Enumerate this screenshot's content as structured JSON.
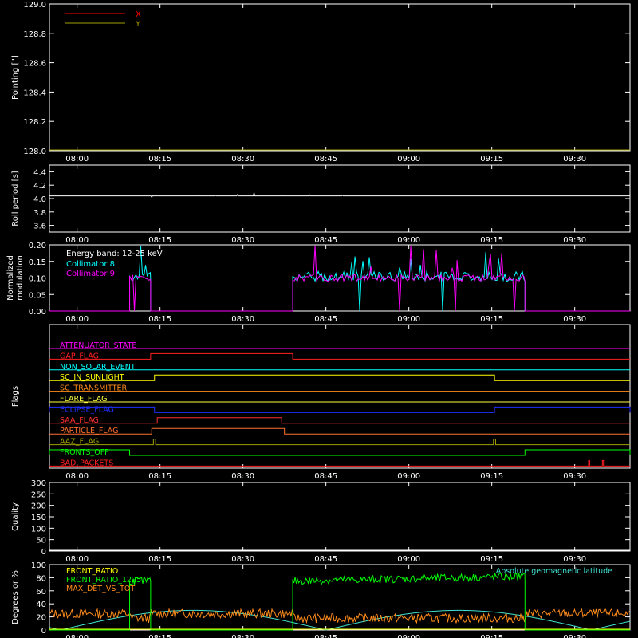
{
  "colors": {
    "background": "#000000",
    "axes": "#ffffff",
    "x_series": "#ff0000",
    "y_series": "#a0a000",
    "collimator8": "#00ffff",
    "collimator9": "#ff00ff",
    "front_ratio": "#00ff00",
    "max_det": "#ff8c1a",
    "geomag": "#40e0d0"
  },
  "chart_data": [
    {
      "id": "pointing",
      "type": "line",
      "ylabel": "Pointing [\"]",
      "ylim": [
        128.0,
        129.0
      ],
      "yticks": [
        "128.0",
        "128.2",
        "128.4",
        "128.6",
        "128.8",
        "129.0"
      ],
      "xlim_minutes": [
        -5,
        100
      ],
      "xticks": [
        "08:00",
        "08:15",
        "08:30",
        "08:45",
        "09:00",
        "09:15",
        "09:30"
      ],
      "legend": [
        {
          "name": "X",
          "color": "#ff0000"
        },
        {
          "name": "Y",
          "color": "#a0a000"
        }
      ],
      "series": [
        {
          "name": "X",
          "values": [
            128.0,
            128.0
          ]
        },
        {
          "name": "Y",
          "values": [
            128.0,
            128.0
          ]
        }
      ]
    },
    {
      "id": "roll",
      "type": "line",
      "ylabel": "Roll period [s]",
      "ylim": [
        3.5,
        4.5
      ],
      "yticks": [
        "3.6",
        "3.8",
        "4.0",
        "4.2",
        "4.4"
      ],
      "xticks": [
        "08:00",
        "08:15",
        "08:30",
        "08:45",
        "09:00",
        "09:15",
        "09:30"
      ],
      "series": [
        {
          "name": "Roll period",
          "x": [
            -5,
            100
          ],
          "values": [
            4.04,
            4.04
          ]
        }
      ],
      "bumps": [
        {
          "x": 13.5,
          "y": 4.02
        },
        {
          "x": 22,
          "y": 4.05
        },
        {
          "x": 25,
          "y": 4.05
        },
        {
          "x": 29,
          "y": 4.06
        },
        {
          "x": 32,
          "y": 4.09
        },
        {
          "x": 37,
          "y": 4.05
        },
        {
          "x": 42,
          "y": 4.06
        },
        {
          "x": 48,
          "y": 4.05
        }
      ]
    },
    {
      "id": "modulation",
      "type": "line",
      "ylabel": "Normalized modulation",
      "ylim": [
        0.0,
        0.2
      ],
      "yticks": [
        "0.00",
        "0.05",
        "0.10",
        "0.15",
        "0.20"
      ],
      "xticks": [
        "08:00",
        "08:15",
        "08:30",
        "08:45",
        "09:00",
        "09:15",
        "09:30"
      ],
      "annotation": "Energy band: 12-25 keV",
      "legend": [
        {
          "name": "Collimator 8",
          "color": "#00ffff"
        },
        {
          "name": "Collimator 9",
          "color": "#ff00ff"
        }
      ],
      "active_intervals": [
        [
          9.5,
          13.3
        ],
        [
          39.0,
          81.0
        ]
      ],
      "base_level": 0.09,
      "peak_level": 0.2
    },
    {
      "id": "flags",
      "type": "step",
      "ylabel": "Flags",
      "xticks": [
        "08:00",
        "08:15",
        "08:30",
        "08:45",
        "09:00",
        "09:15",
        "09:30"
      ],
      "flags": [
        {
          "name": "ATTENUATOR_STATE",
          "color": "#ff00ff",
          "steps": []
        },
        {
          "name": "GAP_FLAG",
          "color": "#ff2020",
          "steps": [
            [
              13.3,
              39.0
            ]
          ]
        },
        {
          "name": "NON_SOLAR_EVENT",
          "color": "#00ffff",
          "steps": []
        },
        {
          "name": "SC_IN_SUNLIGHT",
          "color": "#ffff00",
          "steps": [
            [
              14.0,
              75.5
            ]
          ]
        },
        {
          "name": "SC_TRANSMITTER",
          "color": "#ff8c1a",
          "steps": []
        },
        {
          "name": "FLARE_FLAG",
          "color": "#ffff40",
          "steps": []
        },
        {
          "name": "ECLIPSE_FLAG",
          "color": "#2030ff",
          "steps": [
            [
              -5,
              14.0
            ],
            [
              75.5,
              100
            ]
          ]
        },
        {
          "name": "SAA_FLAG",
          "color": "#ff3030",
          "steps": [
            [
              14.5,
              37.0
            ]
          ]
        },
        {
          "name": "PARTICLE_FLAG",
          "color": "#ff7030",
          "steps": [
            [
              13.5,
              37.5
            ]
          ]
        },
        {
          "name": "AAZ_FLAG",
          "color": "#a0a000",
          "steps": [
            [
              13.8,
              14.2
            ],
            [
              75.3,
              75.7
            ]
          ]
        },
        {
          "name": "FRONTS_OFF",
          "color": "#00ff00",
          "steps": [
            [
              -5,
              9.5
            ],
            [
              81.0,
              100
            ]
          ]
        },
        {
          "name": "BAD_PACKETS",
          "color": "#ff2020",
          "steps": [
            [
              92.5,
              92.7
            ],
            [
              95.0,
              95.2
            ]
          ]
        }
      ]
    },
    {
      "id": "quality",
      "type": "line",
      "ylabel": "Quality",
      "ylim": [
        0,
        300
      ],
      "yticks": [
        "0",
        "50",
        "100",
        "150",
        "200",
        "250",
        "300"
      ],
      "xticks": [
        "08:00",
        "08:15",
        "08:30",
        "08:45",
        "09:00",
        "09:15",
        "09:30"
      ],
      "series": [
        {
          "name": "Quality",
          "x": [
            -5,
            100
          ],
          "values": [
            0,
            0
          ]
        }
      ]
    },
    {
      "id": "ratios",
      "type": "line",
      "ylabel": "Degrees or %",
      "ylim": [
        0,
        100
      ],
      "yticks": [
        "0",
        "20",
        "40",
        "60",
        "80",
        "100"
      ],
      "xticks": [
        "08:00",
        "08:15",
        "08:30",
        "08:45",
        "09:00",
        "09:15",
        "09:30"
      ],
      "legend": [
        {
          "name": "FRONT_RATIO",
          "color": "#ffff00"
        },
        {
          "name": "FRONT_RATIO_1225",
          "color": "#00ff00"
        },
        {
          "name": "MAX_DET_VS_TOT",
          "color": "#ff8c1a"
        }
      ],
      "annotation": "Absolute geomagnetic latitude",
      "front_ratio_1225_intervals": [
        [
          9.5,
          13.3
        ],
        [
          39.0,
          81.0
        ]
      ],
      "front_ratio_level": 75,
      "max_det_level": 25,
      "geomag_period_minutes": 48,
      "geomag_peak": 30
    }
  ]
}
